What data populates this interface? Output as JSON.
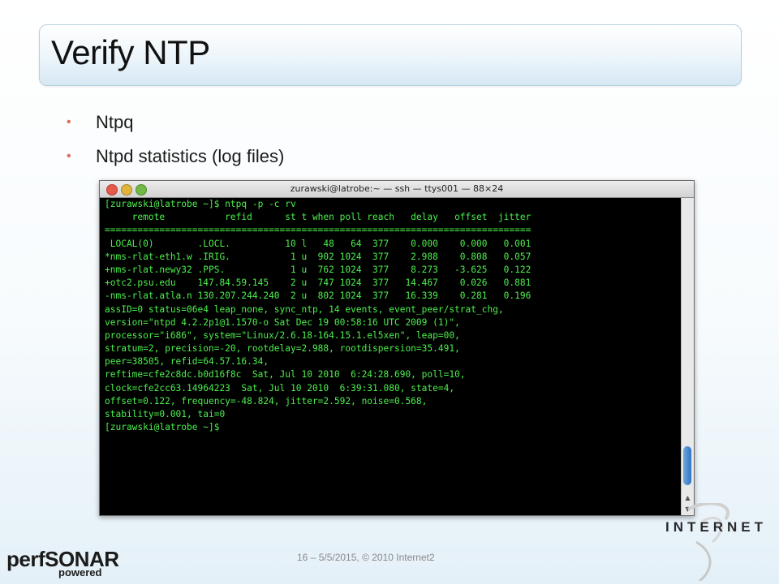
{
  "slide": {
    "title": "Verify NTP",
    "bullets": [
      "Ntpq",
      "Ntpd statistics (log files)"
    ],
    "footer": "16 – 5/5/2015, © 2010 Internet2"
  },
  "terminal": {
    "title": "zurawski@latrobe:~ — ssh — ttys001 — 88×24",
    "lines": [
      "[zurawski@latrobe ~]$ ntpq -p -c rv",
      "     remote           refid      st t when poll reach   delay   offset  jitter",
      "==============================================================================",
      " LOCAL(0)        .LOCL.          10 l   48   64  377    0.000    0.000   0.001",
      "*nms-rlat-eth1.w .IRIG.           1 u  902 1024  377    2.988    0.808   0.057",
      "+nms-rlat.newy32 .PPS.            1 u  762 1024  377    8.273   -3.625   0.122",
      "+otc2.psu.edu    147.84.59.145    2 u  747 1024  377   14.467    0.026   0.881",
      "-nms-rlat.atla.n 130.207.244.240  2 u  802 1024  377   16.339    0.281   0.196",
      "assID=0 status=06e4 leap_none, sync_ntp, 14 events, event_peer/strat_chg,",
      "version=\"ntpd 4.2.2p1@1.1570-o Sat Dec 19 00:58:16 UTC 2009 (1)\",",
      "processor=\"i686\", system=\"Linux/2.6.18-164.15.1.el5xen\", leap=00,",
      "stratum=2, precision=-20, rootdelay=2.988, rootdispersion=35.491,",
      "peer=38505, refid=64.57.16.34,",
      "reftime=cfe2c8dc.b0d16f8c  Sat, Jul 10 2010  6:24:28.690, poll=10,",
      "clock=cfe2cc63.14964223  Sat, Jul 10 2010  6:39:31.080, state=4,",
      "offset=0.122, frequency=-48.824, jitter=2.592, noise=0.568,",
      "stability=0.001, tai=0",
      "[zurawski@latrobe ~]$"
    ],
    "text_color": "#4cf04c"
  },
  "logos": {
    "perfsonar_brand": "perfSONAR",
    "perfsonar_sub": "powered",
    "internet2": "INTERNET"
  },
  "colors": {
    "bullet": "#e0685c",
    "accent": "#2f73c4"
  }
}
